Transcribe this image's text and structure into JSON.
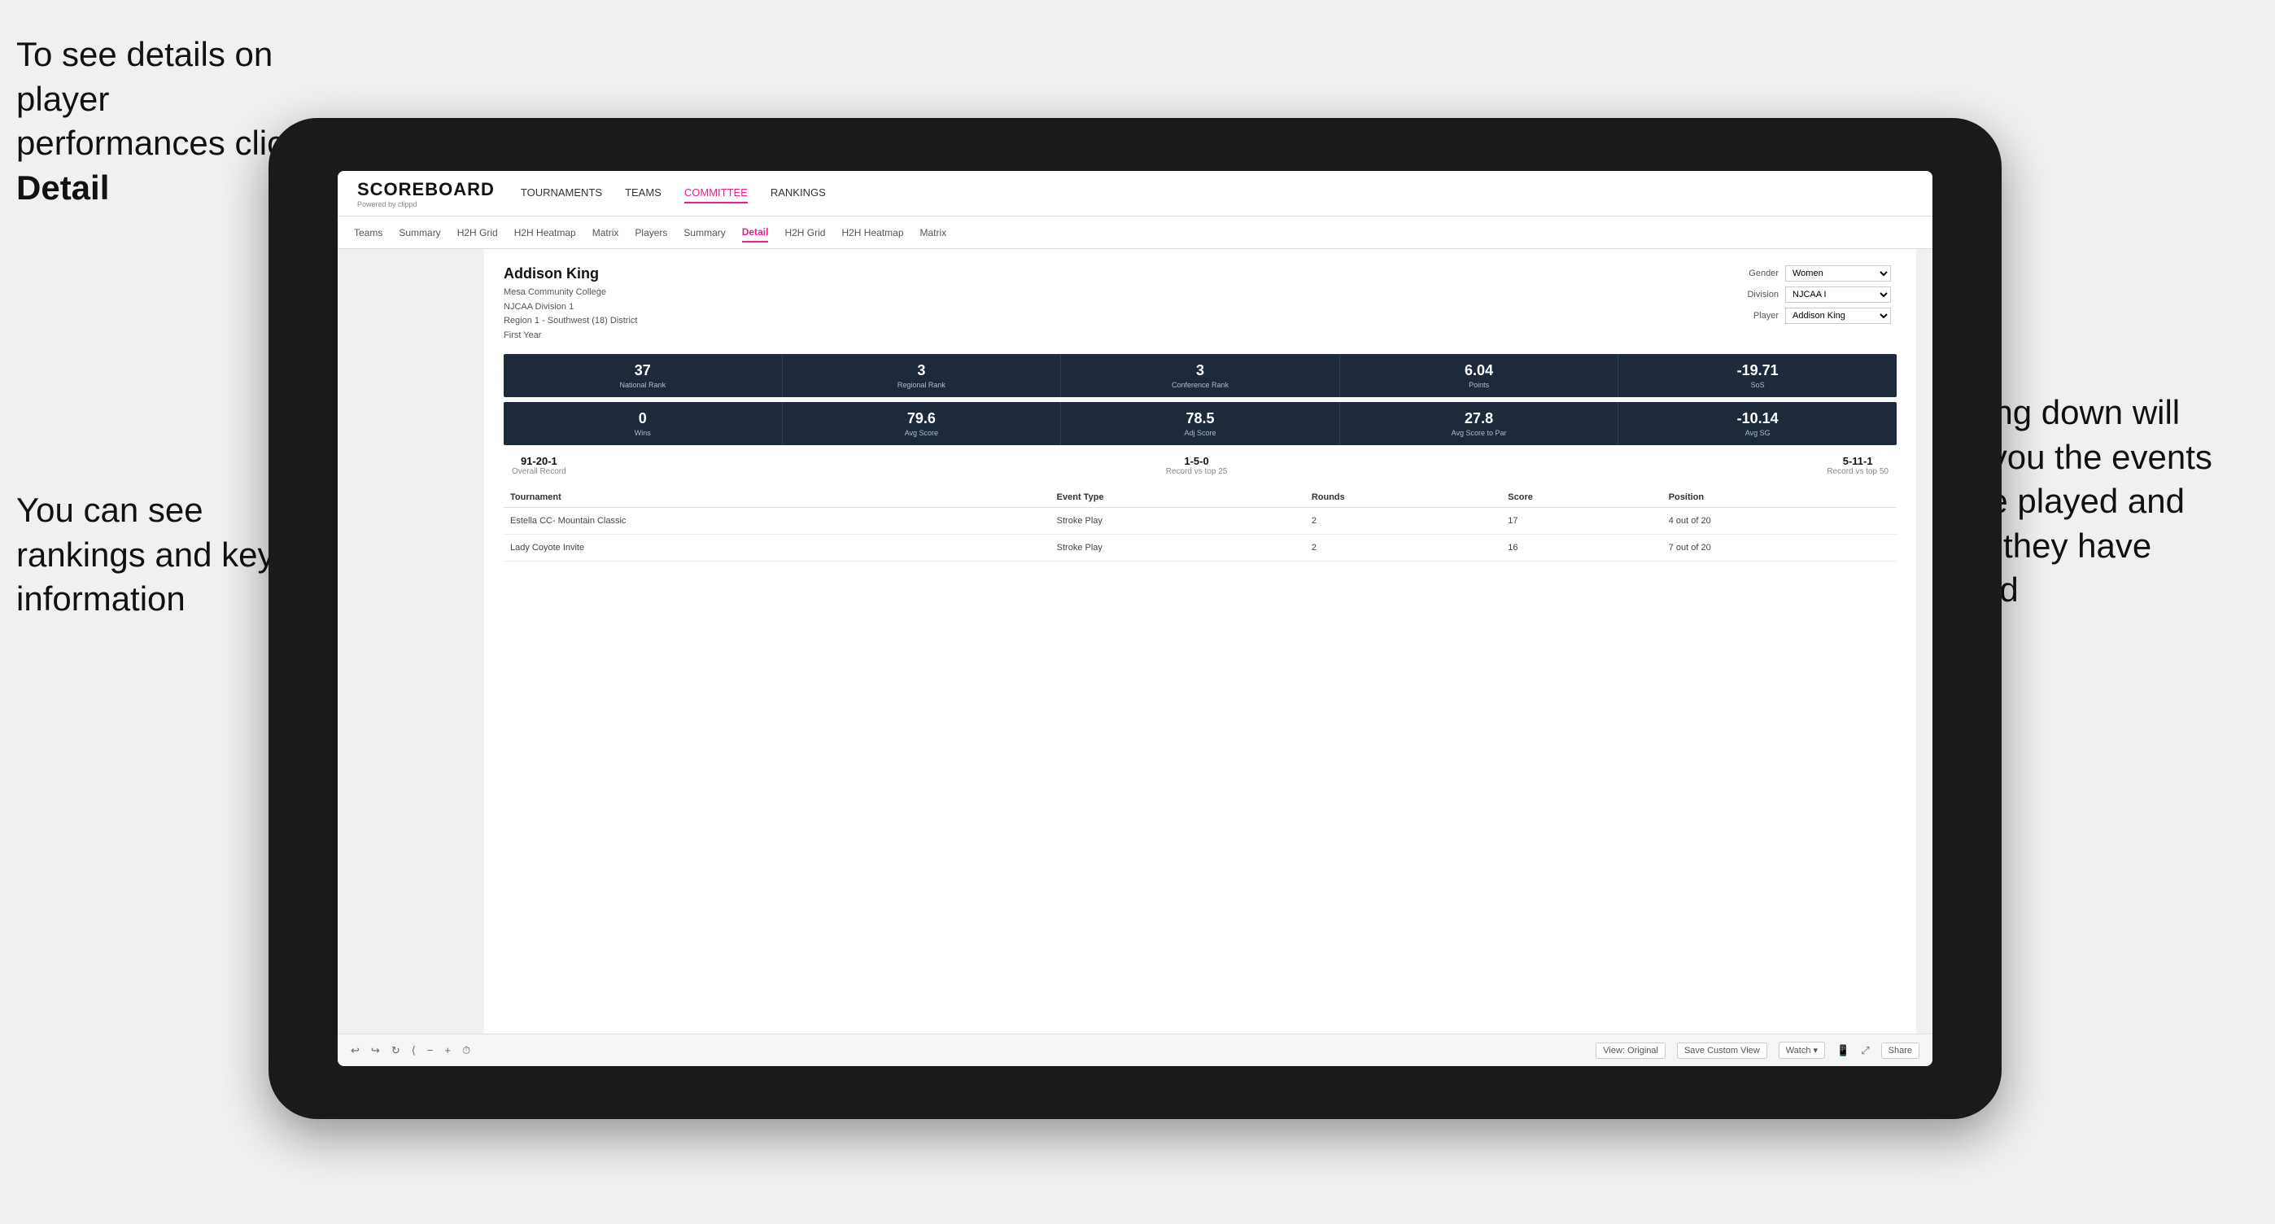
{
  "annotations": {
    "top_left": "To see details on player performances click ",
    "top_left_bold": "Detail",
    "bottom_left_line1": "You can see",
    "bottom_left_line2": "rankings and",
    "bottom_left_line3": "key information",
    "right_line1": "Scrolling down",
    "right_line2": "will show you",
    "right_line3": "the events",
    "right_line4": "they've played",
    "right_line5": "and where they",
    "right_line6": "have finished"
  },
  "nav": {
    "logo": "SCOREBOARD",
    "logo_sub": "Powered by clippd",
    "items": [
      "TOURNAMENTS",
      "TEAMS",
      "COMMITTEE",
      "RANKINGS"
    ]
  },
  "sub_nav": {
    "items": [
      "Teams",
      "Summary",
      "H2H Grid",
      "H2H Heatmap",
      "Matrix",
      "Players",
      "Summary",
      "Detail",
      "H2H Grid",
      "H2H Heatmap",
      "Matrix"
    ],
    "active": "Detail"
  },
  "player": {
    "name": "Addison King",
    "college": "Mesa Community College",
    "division": "NJCAA Division 1",
    "region": "Region 1 - Southwest (18) District",
    "year": "First Year"
  },
  "filters": {
    "gender_label": "Gender",
    "gender_value": "Women",
    "division_label": "Division",
    "division_value": "NJCAA I",
    "player_label": "Player",
    "player_value": "Addison King"
  },
  "stats_row1": [
    {
      "value": "37",
      "label": "National Rank"
    },
    {
      "value": "3",
      "label": "Regional Rank"
    },
    {
      "value": "3",
      "label": "Conference Rank"
    },
    {
      "value": "6.04",
      "label": "Points"
    },
    {
      "value": "-19.71",
      "label": "SoS"
    }
  ],
  "stats_row2": [
    {
      "value": "0",
      "label": "Wins"
    },
    {
      "value": "79.6",
      "label": "Avg Score"
    },
    {
      "value": "78.5",
      "label": "Adj Score"
    },
    {
      "value": "27.8",
      "label": "Avg Score to Par"
    },
    {
      "value": "-10.14",
      "label": "Avg SG"
    }
  ],
  "records": [
    {
      "value": "91-20-1",
      "label": "Overall Record"
    },
    {
      "value": "1-5-0",
      "label": "Record vs top 25"
    },
    {
      "value": "5-11-1",
      "label": "Record vs top 50"
    }
  ],
  "table": {
    "headers": [
      "Tournament",
      "Event Type",
      "Rounds",
      "Score",
      "Position"
    ],
    "rows": [
      {
        "tournament": "Estella CC- Mountain Classic",
        "event_type": "Stroke Play",
        "rounds": "2",
        "score": "17",
        "position": "4 out of 20"
      },
      {
        "tournament": "Lady Coyote Invite",
        "event_type": "Stroke Play",
        "rounds": "2",
        "score": "16",
        "position": "7 out of 20"
      }
    ]
  },
  "toolbar": {
    "view_label": "View: Original",
    "save_label": "Save Custom View",
    "watch_label": "Watch ▾",
    "share_label": "Share"
  }
}
